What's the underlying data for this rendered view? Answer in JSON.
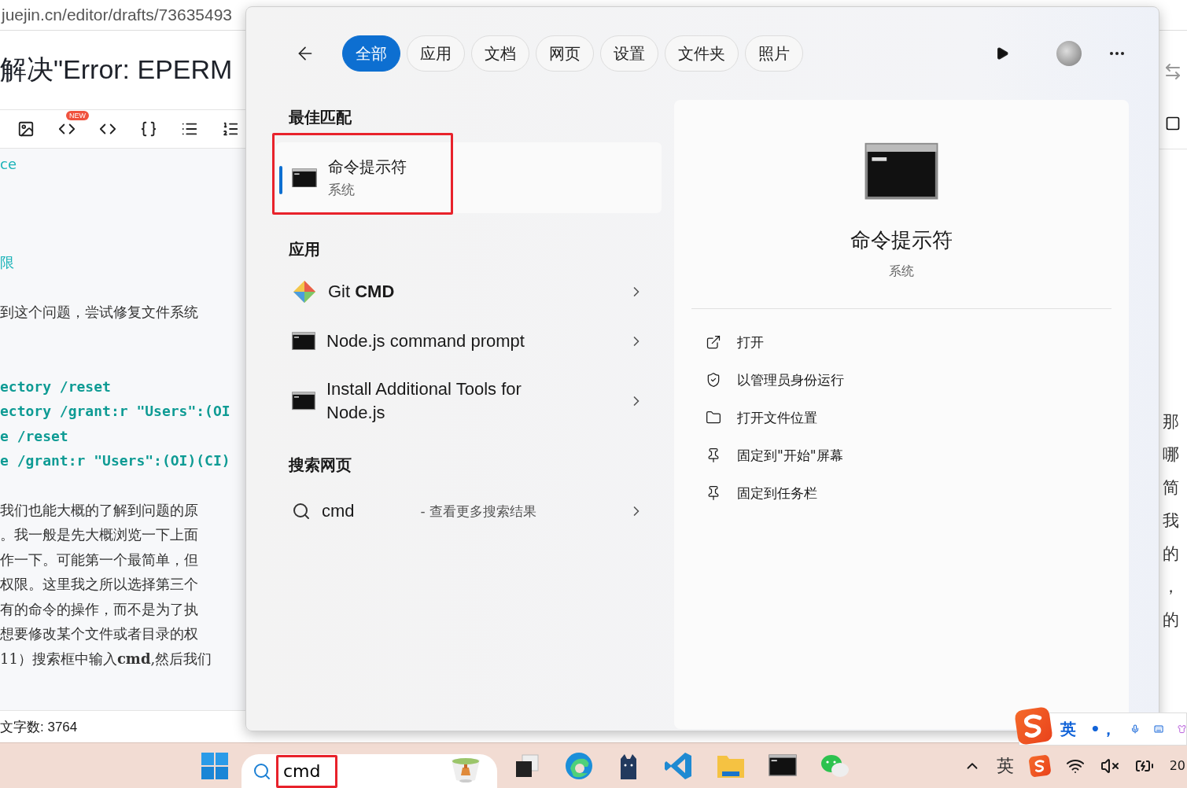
{
  "browser": {
    "url": "juejin.cn/editor/drafts/73635493",
    "article_title": "解决\"Error: EPERM",
    "new_badge": "NEW",
    "editor_lines": [
      {
        "kind": "link",
        "text": "ce"
      },
      {
        "kind": "link",
        "text": "限"
      },
      {
        "kind": "text",
        "text": "到这个问题，尝试修复文件系统"
      },
      {
        "kind": "code",
        "text": "ectory /reset"
      },
      {
        "kind": "code",
        "text": "ectory /grant:r \"Users\":(OI"
      },
      {
        "kind": "code",
        "text": "e /reset"
      },
      {
        "kind": "code",
        "text": "e /grant:r \"Users\":(OI)(CI)"
      },
      {
        "kind": "text",
        "text": "我们也能大概的了解到问题的原"
      },
      {
        "kind": "text",
        "text": "。我一般是先大概浏览一下上面"
      },
      {
        "kind": "text",
        "text": "作一下。可能第一个最简单，但"
      },
      {
        "kind": "text",
        "text": "权限。这里我之所以选择第三个"
      },
      {
        "kind": "text",
        "text": "有的命令的操作，而不是为了执"
      },
      {
        "kind": "text",
        "text": "想要修改某个文件或者目录的权"
      },
      {
        "kind": "text",
        "text": "11）搜索框中输入**cmd**,然后我们"
      }
    ],
    "word_count": "文字数: 3764",
    "right_fragments": [
      "那",
      "哪",
      "简",
      "我",
      "的",
      "，",
      "的"
    ]
  },
  "search_panel": {
    "tabs": [
      {
        "label": "全部",
        "selected": true
      },
      {
        "label": "应用",
        "selected": false
      },
      {
        "label": "文档",
        "selected": false
      },
      {
        "label": "网页",
        "selected": false
      },
      {
        "label": "设置",
        "selected": false
      },
      {
        "label": "文件夹",
        "selected": false
      },
      {
        "label": "照片",
        "selected": false
      }
    ],
    "best_match": {
      "heading": "最佳匹配",
      "name": "命令提示符",
      "subtitle": "系统",
      "selected": true
    },
    "apps": {
      "heading": "应用",
      "items": [
        {
          "kind": "git",
          "label": "Git **CMD**"
        },
        {
          "kind": "console",
          "label": "Node.js command prompt"
        },
        {
          "kind": "console",
          "label": "Install Additional Tools for Node.js"
        }
      ]
    },
    "web": {
      "heading": "搜索网页",
      "query": "cmd",
      "hint": "- 查看更多搜索结果"
    },
    "detail": {
      "name": "命令提示符",
      "subtitle": "系统",
      "actions": [
        {
          "kind": "open",
          "label": "打开"
        },
        {
          "kind": "admin",
          "label": "以管理员身份运行"
        },
        {
          "kind": "folder",
          "label": "打开文件位置"
        },
        {
          "kind": "pin",
          "label": "固定到\"开始\"屏幕"
        },
        {
          "kind": "pin",
          "label": "固定到任务栏"
        }
      ]
    }
  },
  "ime_bar": {
    "language": "英",
    "punctuation": "•，"
  },
  "taskbar": {
    "search_value": "cmd",
    "apps": [
      {
        "kind": "taskview"
      },
      {
        "kind": "edge"
      },
      {
        "kind": "cat"
      },
      {
        "kind": "vscode"
      },
      {
        "kind": "folder"
      },
      {
        "kind": "terminal"
      },
      {
        "kind": "wechat"
      }
    ],
    "input_language": "英",
    "clock": "20"
  }
}
